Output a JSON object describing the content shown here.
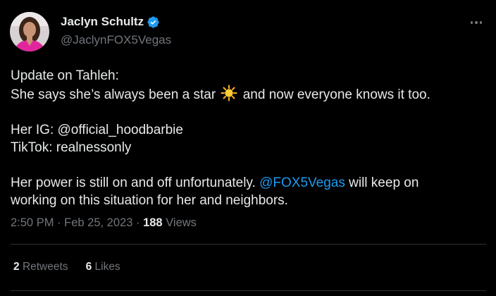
{
  "author": {
    "display_name": "Jaclyn Schultz",
    "handle": "@JaclynFOX5Vegas",
    "verified_icon": "verified-badge-icon",
    "verified_color": "#1d9bf0"
  },
  "tweet": {
    "line1": "Update on Tahleh:",
    "line2_before": "She says she’s always been a star",
    "line2_after": "and now everyone knows it too.",
    "emoji_icon": "sun-emoji-icon",
    "line3": "Her IG: @official_hoodbarbie",
    "line4": "TikTok: realnessonly",
    "line5_before": "Her power is still on and off unfortunately.",
    "line5_mention": "@FOX5Vegas",
    "line5_after": "will keep on",
    "line6": "working on this situation for her and neighbors."
  },
  "meta": {
    "time": "2:50 PM",
    "sep1": "·",
    "date": "Feb 25, 2023",
    "sep2": "·",
    "views_count": "188",
    "views_label": "Views"
  },
  "stats": {
    "retweets_count": "2",
    "retweets_label": "Retweets",
    "likes_count": "6",
    "likes_label": "Likes"
  },
  "colors": {
    "background": "#000000",
    "text": "#e7e9ea",
    "secondary": "#71767b",
    "link": "#1d9bf0",
    "divider": "#2f3336"
  }
}
